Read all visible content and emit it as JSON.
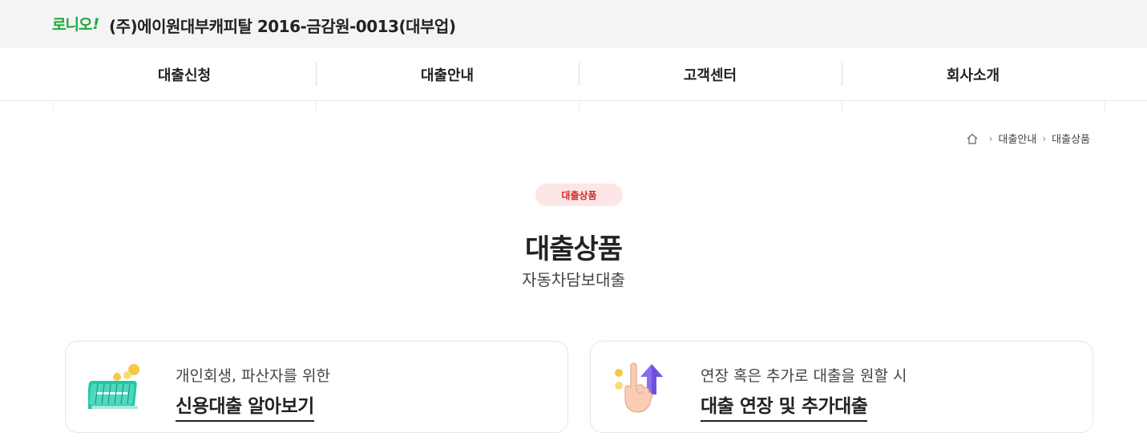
{
  "header": {
    "logo_text": "로니오",
    "logo_mark": "!",
    "company": "(주)에이원대부캐피탈 2016-금감원-0013(대부업)",
    "brand_color": "#1fa83c"
  },
  "nav": {
    "items": [
      "대출신청",
      "대출안내",
      "고객센터",
      "회사소개"
    ]
  },
  "breadcrumb": {
    "home_icon": "home-icon",
    "items": [
      "대출안내",
      "대출상품"
    ]
  },
  "hero": {
    "badge": "대출상품",
    "title": "대출상품",
    "subtitle": "자동차담보대출",
    "badge_color": "#d12a2a"
  },
  "cards": [
    {
      "icon": "calendar-coins-icon",
      "desc": "개인회생, 파산자를 위한",
      "link": "신용대출 알아보기"
    },
    {
      "icon": "hand-arrow-up-icon",
      "desc": "연장 혹은 추가로 대출을 원할 시",
      "link": "대출 연장 및 추가대출"
    }
  ]
}
